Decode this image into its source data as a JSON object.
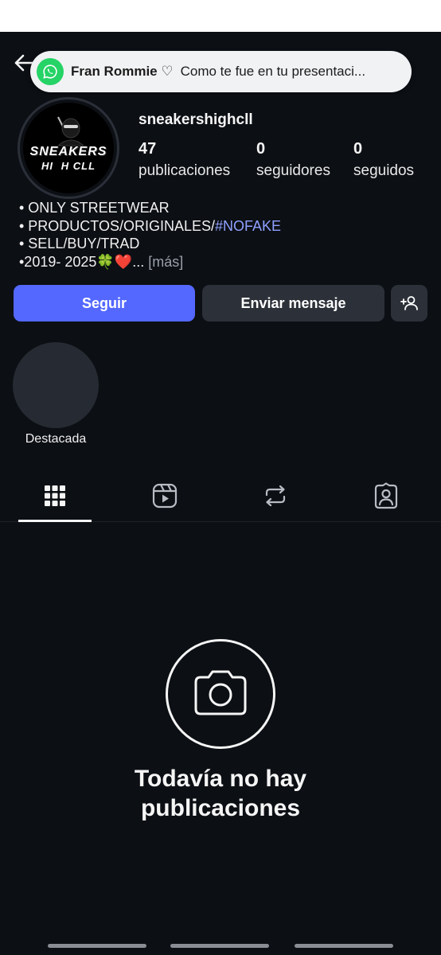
{
  "notification": {
    "app_icon": "whatsapp-icon",
    "sender": "Fran Rommie ♡",
    "message": "Como te fue en tu presentaci..."
  },
  "profile": {
    "username": "sneakershighcll",
    "avatar_logo_line1": "SNEAKERS",
    "avatar_logo_line2": "HI⃠H CLL",
    "stats": {
      "posts_count": "47",
      "posts_label": "publicaciones",
      "followers_count": "0",
      "followers_label": "seguidores",
      "following_count": "0",
      "following_label": "seguidos"
    },
    "bio": {
      "line1": "• ONLY STREETWEAR",
      "line2_prefix": "• PRODUCTOS/ORIGINALES/",
      "line2_hashtag": "#NOFAKE",
      "line3": "• SELL/BUY/TRAD",
      "line4": "•2019- 2025🍀❤️...",
      "more": "[más]"
    }
  },
  "actions": {
    "follow_label": "Seguir",
    "message_label": "Enviar mensaje",
    "suggest_icon": "add-person-icon"
  },
  "highlights": [
    {
      "label": "Destacada"
    }
  ],
  "tabs": [
    {
      "icon": "grid-icon",
      "selected": true
    },
    {
      "icon": "reels-icon",
      "selected": false
    },
    {
      "icon": "repost-icon",
      "selected": false
    },
    {
      "icon": "tagged-icon",
      "selected": false
    }
  ],
  "empty_state": {
    "icon": "camera-icon",
    "line1": "Todavía no hay",
    "line2": "publicaciones"
  },
  "colors": {
    "background": "#0c0f14",
    "follow_button": "#5468ff",
    "secondary_button": "#2c3038",
    "hashtag": "#8fa0ff",
    "whatsapp": "#25d366"
  }
}
